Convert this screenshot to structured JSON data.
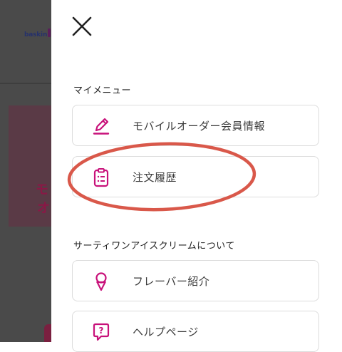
{
  "background": {
    "logo_text": "baskin",
    "banner_text_1": "モ",
    "banner_text_2": "オ"
  },
  "drawer": {
    "close_icon": "close-icon",
    "sections": [
      {
        "title": "マイメニュー",
        "items": [
          {
            "label": "モバイルオーダー会員情報",
            "icon": "pencil-icon"
          },
          {
            "label": "注文履歴",
            "icon": "clipboard-list-icon"
          }
        ]
      },
      {
        "title": "サーティワンアイスクリームについて",
        "items": [
          {
            "label": "フレーバー紹介",
            "icon": "ice-cream-cone-icon"
          },
          {
            "label": "ヘルプページ",
            "icon": "help-bubble-icon"
          }
        ]
      }
    ]
  },
  "colors": {
    "accent": "#c8117a",
    "overlay": "#4a4a4a",
    "annotation": "#d9584a"
  }
}
